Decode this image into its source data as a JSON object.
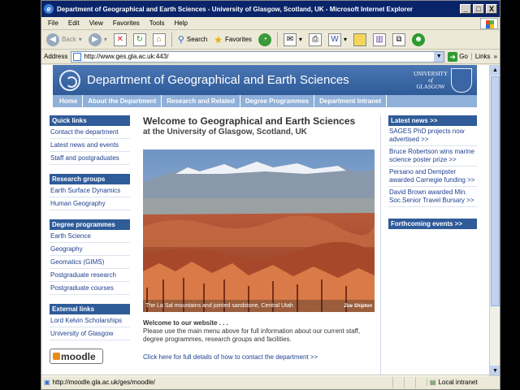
{
  "window": {
    "title": "Department of Geographical and Earth Sciences - University of Glasgow, Scotland, UK - Microsoft Internet Explorer",
    "min": "_",
    "max": "□",
    "close": "X"
  },
  "menu": [
    "File",
    "Edit",
    "View",
    "Favorites",
    "Tools",
    "Help"
  ],
  "toolbar": {
    "back": "Back",
    "search": "Search",
    "favorites": "Favorites"
  },
  "address": {
    "label": "Address",
    "url": "http://www.ges.gla.ac.uk:443/",
    "go": "Go",
    "links": "Links"
  },
  "page": {
    "banner_title": "Department of Geographical and Earth Sciences",
    "university_lines": [
      "UNIVERSITY",
      "of",
      "GLASGOW"
    ],
    "nav": [
      "Home",
      "About the Department",
      "Research and Related",
      "Degree Programmes",
      "Department Intranet"
    ],
    "sidebar": [
      {
        "head": "Quick links",
        "links": [
          "Contact the department",
          "Latest news and events",
          "Staff and postgraduates"
        ]
      },
      {
        "head": "Research groups",
        "links": [
          "Earth Surface Dynamics",
          "Human Geography"
        ]
      },
      {
        "head": "Degree programmes",
        "links": [
          "Earth Science",
          "Geography",
          "Geomatics (GIMS)",
          "Postgraduate research",
          "Postgraduate courses"
        ]
      },
      {
        "head": "External links",
        "links": [
          "Lord Kelvin Scholarships",
          "University of Glasgow"
        ]
      }
    ],
    "moodle": "moodle",
    "welcome_title": "Welcome to Geographical and Earth Sciences",
    "welcome_subtitle": "at the University of Glasgow, Scotland, UK",
    "photo_caption": "The La Sal mountains and jointed sandstone, Central Utah",
    "photo_credit": "Zoe Shipton",
    "welcome_head": "Welcome to our website . . .",
    "welcome_body": "Please use the main menu above for full information about our current staff, degree programmes, research groups and facilities.",
    "contact_link": "Click here for full details of how to contact the department >>",
    "latest_news_head": "Latest news >>",
    "news": [
      "SAGES PhD projects now advertised >>",
      "Bruce Robertson wins marine science poster prize >>",
      "Persano and Dempster awarded Carnegie funding >>",
      "David Brown awarded Min. Soc.Senior Travel Bursary >>"
    ],
    "forthcoming_head": "Forthcoming events >>"
  },
  "status": {
    "url": "http://moodle.gla.ac.uk/ges/moodle/",
    "zone": "Local intranet"
  }
}
